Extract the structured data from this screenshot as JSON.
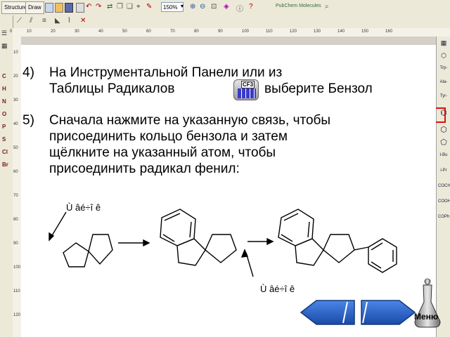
{
  "toolbar": {
    "tab_structure": "Structure",
    "tab_draw": "Draw",
    "zoom": "150%",
    "brand": "PubChem Molecules"
  },
  "rulers": {
    "h_ticks": [
      "10",
      "20",
      "30",
      "40",
      "50",
      "60",
      "70",
      "80",
      "90",
      "100",
      "110",
      "120",
      "130",
      "140",
      "150",
      "160"
    ],
    "v_ticks": [
      "10",
      "20",
      "30",
      "40",
      "50",
      "60",
      "70",
      "80",
      "90",
      "100",
      "110",
      "120"
    ]
  },
  "left_palette": {
    "elements": [
      "C",
      "H",
      "N",
      "O",
      "P",
      "S",
      "Cl",
      "Br"
    ]
  },
  "right_palette": {
    "items": [
      "Trp-",
      "Ala-",
      "Tyr-",
      "t-Bu",
      "i-Pr",
      "COCH3",
      "COOH",
      "COPh"
    ]
  },
  "instructions": {
    "step4_num": "4)",
    "step4_line1": "На Инструментальной Панели или из",
    "step4_line2a": "Таблицы Радикалов",
    "step4_line2b": "выберите Бензол",
    "step5_num": "5)",
    "step5_line1": "Сначала нажмите на указанную связь, чтобы",
    "step5_line2": "присоединить кольцо бензола и затем",
    "step5_line3": "щёлкните на указанный атом, чтобы",
    "step5_line4": "присоединить радикал фенил:"
  },
  "cf3_icon_label": "CF3",
  "diagram": {
    "annot_top": "Ù âé÷î ê",
    "annot_bottom": "Ù âé÷î ê"
  },
  "nav": {
    "menu_label": "Меню"
  }
}
